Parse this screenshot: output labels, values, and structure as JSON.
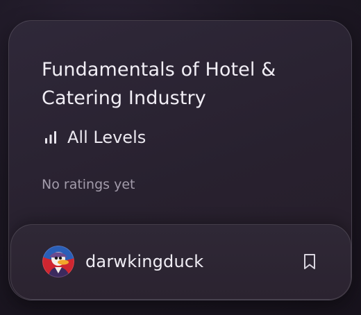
{
  "course": {
    "title": "Fundamentals of Hotel & Catering Industry",
    "level_icon": "bar-chart-icon",
    "level": "All Levels",
    "ratings_text": "No ratings yet"
  },
  "author": {
    "avatar_icon": "duck-avatar",
    "username": "darwkingduck",
    "bookmark_icon": "bookmark-icon"
  },
  "colors": {
    "background": "#1d1824",
    "card": "#2b2431",
    "text_primary": "#f1eef5",
    "text_muted": "#a39cab"
  }
}
